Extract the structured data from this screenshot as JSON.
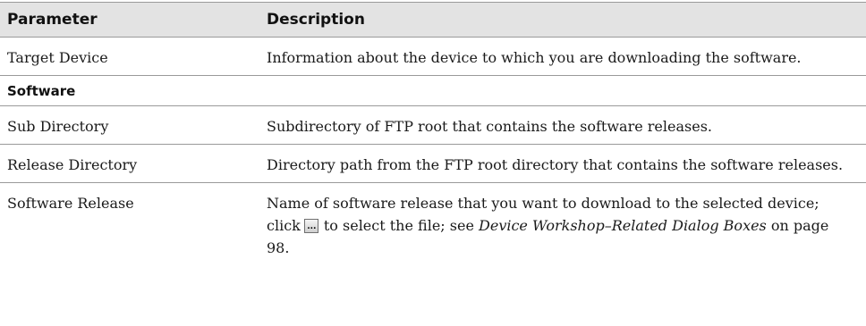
{
  "table": {
    "header": {
      "parameter": "Parameter",
      "description": "Description"
    },
    "rows": [
      {
        "parameter": "Target Device",
        "description": "Information about the device to which you are downloading the software."
      }
    ],
    "section": {
      "title": "Software",
      "rows": [
        {
          "parameter": "Sub Directory",
          "description": "Subdirectory of FTP root that contains the software releases."
        },
        {
          "parameter": "Release Directory",
          "description": "Directory path from the FTP root directory that contains the software releases."
        },
        {
          "parameter": "Software Release",
          "description_before": "Name of software release that you want to download to the selected device; click",
          "button_icon": "ellipsis-browse-icon",
          "description_middle": "to select the file; see",
          "link_text": "Device Workshop–Related Dialog Boxes",
          "description_after": "on page 98."
        }
      ]
    }
  }
}
